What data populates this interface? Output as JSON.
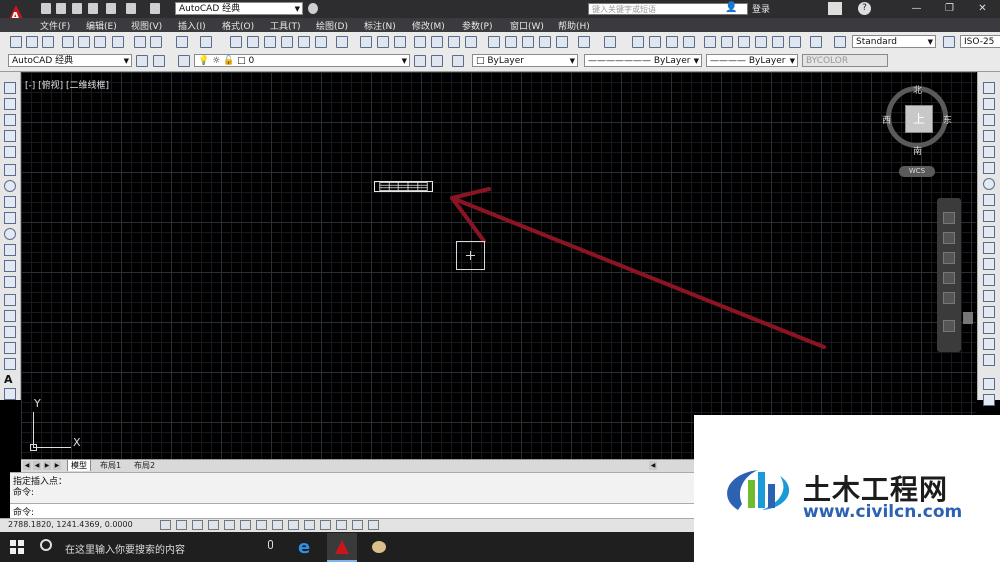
{
  "titlebar": {
    "workspace": "AutoCAD 经典",
    "search_placeholder": "键入关键字或短语",
    "login": "登录",
    "help": "?"
  },
  "menubar": {
    "items": [
      "文件(F)",
      "编辑(E)",
      "视图(V)",
      "插入(I)",
      "格式(O)",
      "工具(T)",
      "绘图(D)",
      "标注(N)",
      "修改(M)",
      "参数(P)",
      "窗口(W)",
      "帮助(H)"
    ]
  },
  "toolbar1": {
    "text_style": "Standard",
    "dim_style": "ISO-25"
  },
  "toolbar2": {
    "workspace": "AutoCAD 经典",
    "layer": "0",
    "color": "ByLayer",
    "linetype": "ByLayer",
    "lineweight": "ByLayer",
    "plot_style": "BYCOLOR"
  },
  "viewport": {
    "label": "[-] [俯视] [二维线框]",
    "compass": {
      "north": "北",
      "south": "南",
      "east": "东",
      "west": "西"
    },
    "cube_face": "上",
    "wcs": "WCS",
    "ucs_x": "X",
    "ucs_y": "Y"
  },
  "tabs": [
    "模型",
    "布局1",
    "布局2"
  ],
  "command": {
    "history_line1": "指定插入点：",
    "history_line2": "命令:",
    "prompt": "命令:"
  },
  "status": {
    "coordinates": "2788.1820, 1241.4369, 0.0000"
  },
  "taskbar": {
    "search_text": "在这里输入你要搜索的内容"
  },
  "watermark": {
    "title": "土木工程网",
    "url": "www.civilcn.com"
  },
  "colors": {
    "arrow": "#8b1423",
    "background": "#000000",
    "watermark_blue": "#2d62b3"
  }
}
